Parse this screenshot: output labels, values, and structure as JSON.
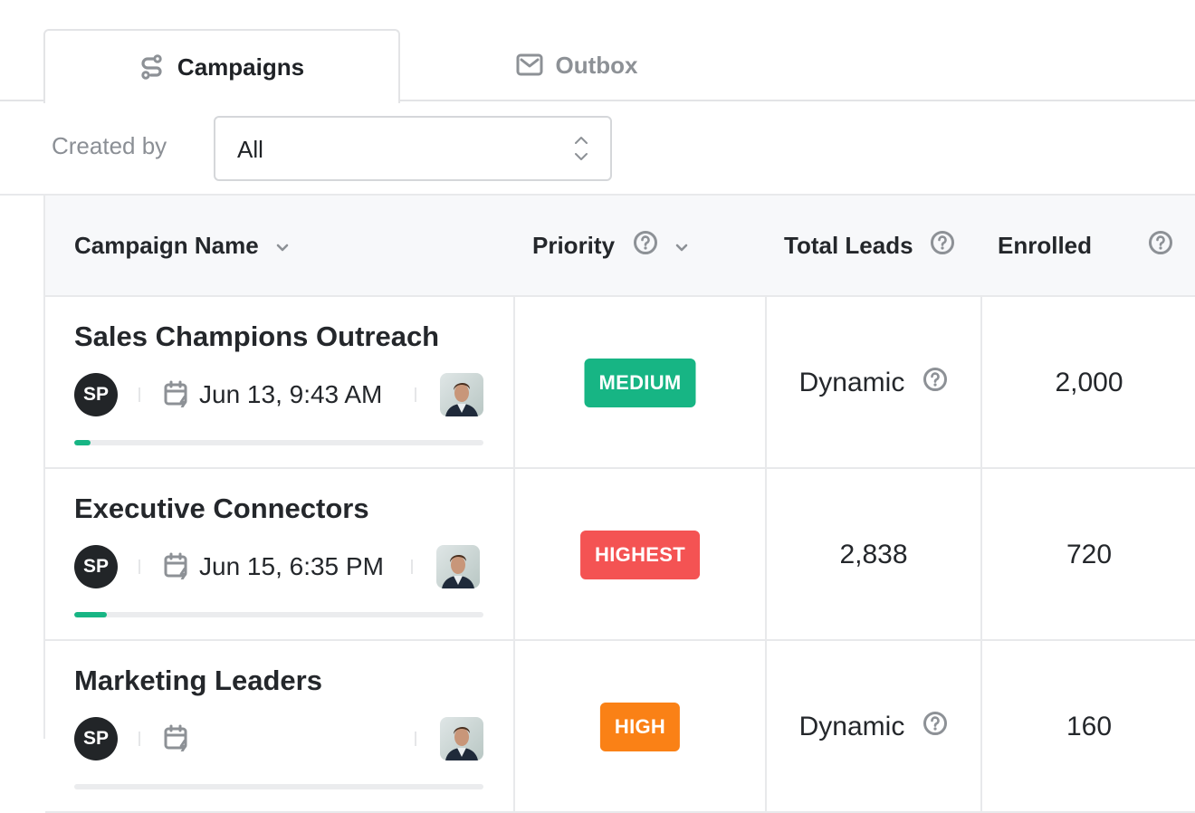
{
  "tabs": [
    {
      "label": "Campaigns",
      "icon": "route-icon",
      "active": true
    },
    {
      "label": "Outbox",
      "icon": "mail-icon",
      "active": false
    }
  ],
  "filter": {
    "label": "Created by",
    "value": "All"
  },
  "columns": [
    {
      "label": "Campaign Name",
      "help": false,
      "sort": true
    },
    {
      "label": "Priority",
      "help": true,
      "sort": true
    },
    {
      "label": "Total Leads",
      "help": true,
      "sort": false
    },
    {
      "label": "Enrolled",
      "help": true,
      "sort": false
    }
  ],
  "rows": [
    {
      "name": "Sales Champions Outreach",
      "owner_initials": "SP",
      "date": "Jun 13, 9:43 AM",
      "progress": 0.04,
      "priority": "MEDIUM",
      "priority_color": "#17b584",
      "total_leads": "Dynamic",
      "total_leads_help": true,
      "enrolled": "2,000"
    },
    {
      "name": "Executive Connectors",
      "owner_initials": "SP",
      "date": "Jun 15, 6:35 PM",
      "progress": 0.08,
      "priority": "HIGHEST",
      "priority_color": "#f45353",
      "total_leads": "2,838",
      "total_leads_help": false,
      "enrolled": "720"
    },
    {
      "name": "Marketing Leaders",
      "owner_initials": "SP",
      "date": "",
      "progress": 0,
      "priority": "HIGH",
      "priority_color": "#fa8116",
      "total_leads": "Dynamic",
      "total_leads_help": true,
      "enrolled": "160"
    }
  ],
  "colors": {
    "accent_green": "#17b584",
    "priority_highest": "#f45353",
    "priority_high": "#fa8116",
    "priority_medium": "#17b584"
  }
}
